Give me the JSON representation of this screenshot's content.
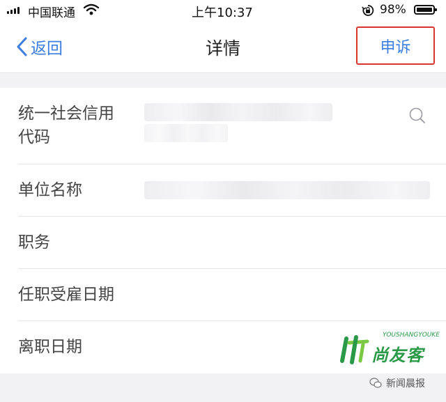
{
  "status_bar": {
    "carrier": "中国联通",
    "time": "上午10:37",
    "battery_percent": "98%",
    "battery_level": 0.98,
    "icons": [
      "signal-icon",
      "wifi-icon",
      "orientation-lock-icon",
      "battery-icon"
    ]
  },
  "nav": {
    "back_label": "返回",
    "title": "详情",
    "appeal_label": "申诉",
    "accent_color": "#3b7de0",
    "highlight_color": "#d8352f"
  },
  "form": {
    "fields": [
      {
        "label_line1": "统一社会信用",
        "label_line2": "代码",
        "value_blurred": true
      },
      {
        "label": "单位名称",
        "value_blurred": true
      },
      {
        "label": "职务"
      },
      {
        "label": "任职受雇日期"
      },
      {
        "label": "离职日期"
      }
    ]
  },
  "watermark": {
    "brand_small": "YOUSHANGYOUKE",
    "brand_name": "尚友客",
    "source": "新闻晨报"
  }
}
